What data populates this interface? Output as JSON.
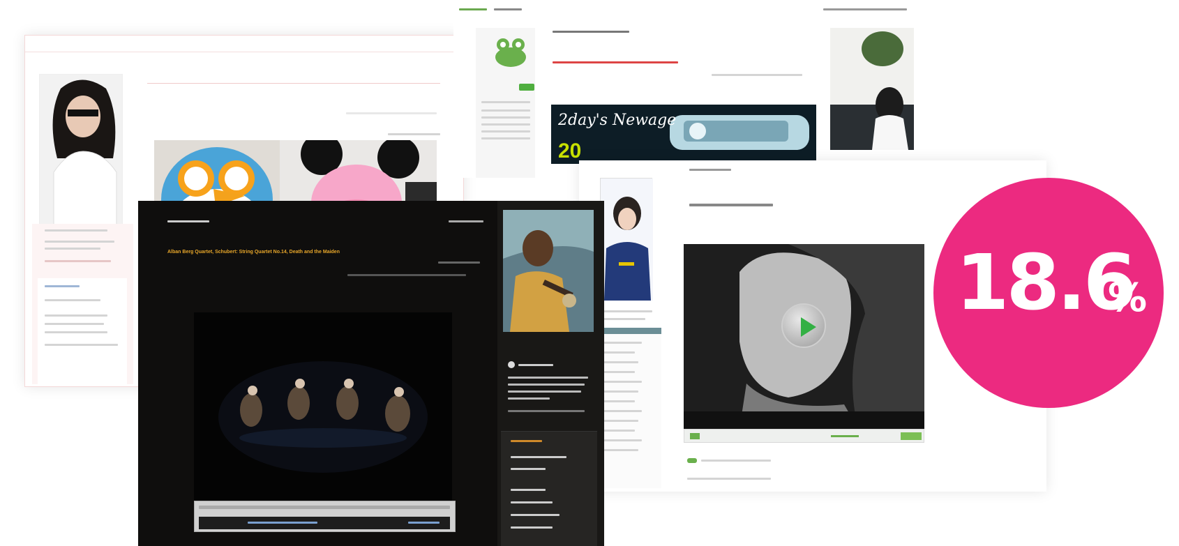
{
  "mid_card": {
    "banner_title": "2day's Newage",
    "banner_number": "20"
  },
  "dark_card": {
    "post_title": "Alban Berg Quartet, Schubert: String Quartet No.14, Death and the Maiden"
  },
  "stat_badge": {
    "value": "18.6",
    "unit": "%",
    "color": "#ec2a80"
  },
  "icons": [
    "play-icon",
    "avatar-icon"
  ]
}
